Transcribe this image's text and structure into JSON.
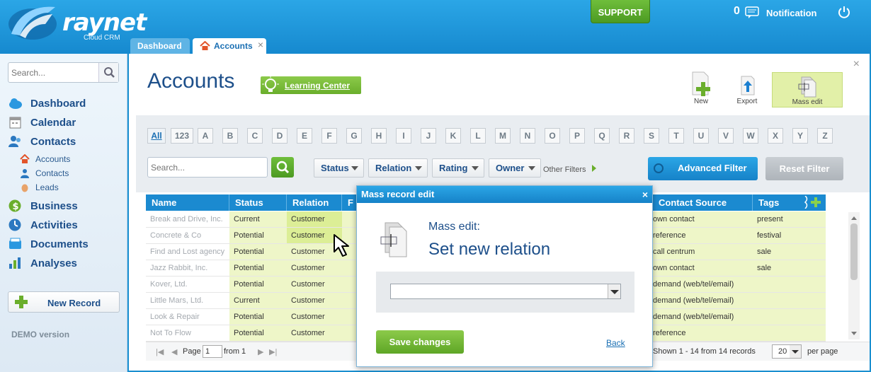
{
  "brand": {
    "name": "raynet",
    "subtitle": "Cloud CRM"
  },
  "header": {
    "support_label": "SUPPORT",
    "notification_count": "0",
    "notification_label": "Notification"
  },
  "tabs": [
    {
      "label": "Dashboard"
    },
    {
      "label": "Accounts",
      "close": "×"
    }
  ],
  "sidebar": {
    "search_placeholder": "Search...",
    "nav": [
      {
        "label": "Dashboard",
        "icon": "cloud-icon"
      },
      {
        "label": "Calendar",
        "icon": "calendar-icon"
      },
      {
        "label": "Contacts",
        "icon": "contacts-icon"
      }
    ],
    "subnav": [
      {
        "label": "Accounts",
        "icon": "home-icon"
      },
      {
        "label": "Contacts",
        "icon": "person-icon"
      },
      {
        "label": "Leads",
        "icon": "egg-icon"
      }
    ],
    "nav2": [
      {
        "label": "Business",
        "icon": "dollar-icon"
      },
      {
        "label": "Activities",
        "icon": "clock-icon"
      },
      {
        "label": "Documents",
        "icon": "documents-icon"
      },
      {
        "label": "Analyses",
        "icon": "bar-chart-icon"
      }
    ],
    "new_record_label": "New Record",
    "demo_label": "DEMO version"
  },
  "main": {
    "title": "Accounts",
    "learning_center": "Learning Center",
    "close": "×",
    "toolbar": {
      "new_label": "New",
      "export_label": "Export",
      "mass_edit_label": "Mass edit"
    },
    "alphabet": [
      "All",
      "123",
      "A",
      "B",
      "C",
      "D",
      "E",
      "F",
      "G",
      "H",
      "I",
      "J",
      "K",
      "L",
      "M",
      "N",
      "O",
      "P",
      "Q",
      "R",
      "S",
      "T",
      "U",
      "V",
      "W",
      "X",
      "Y",
      "Z"
    ],
    "search_placeholder": "Search...",
    "filters": [
      "Status",
      "Relation",
      "Rating",
      "Owner"
    ],
    "other_filters": "Other Filters",
    "advanced_filter": "Advanced Filter",
    "reset_filter": "Reset Filter"
  },
  "table": {
    "columns": [
      "Name",
      "Status",
      "Relation",
      "F",
      "Contact Source",
      "Tags"
    ],
    "rows": [
      {
        "name": "Break and Drive, Inc.",
        "status": "Current",
        "relation": "Customer",
        "source": "own contact",
        "tags": "present"
      },
      {
        "name": "Concrete & Co",
        "status": "Potential",
        "relation": "Customer",
        "source": "reference",
        "tags": "festival"
      },
      {
        "name": "Find and Lost agency",
        "status": "Potential",
        "relation": "Customer",
        "source": "call centrum",
        "tags": "sale"
      },
      {
        "name": "Jazz Rabbit, Inc.",
        "status": "Potential",
        "relation": "Customer",
        "source": "own contact",
        "tags": "sale"
      },
      {
        "name": "Kover, Ltd.",
        "status": "Potential",
        "relation": "Customer",
        "source": "demand (web/tel/email)",
        "tags": ""
      },
      {
        "name": "Little Mars, Ltd.",
        "status": "Current",
        "relation": "Customer",
        "source": "demand (web/tel/email)",
        "tags": ""
      },
      {
        "name": "Look & Repair",
        "status": "Potential",
        "relation": "Customer",
        "source": "demand (web/tel/email)",
        "tags": ""
      },
      {
        "name": "Not To Flow",
        "status": "Potential",
        "relation": "Customer",
        "source": "reference",
        "tags": ""
      }
    ],
    "pager": {
      "page_label": "Page",
      "page_value": "1",
      "from_label": "from 1",
      "shown": "Shown 1 - 14 from 14 records",
      "per_page_value": "20",
      "per_page_label": "per page"
    }
  },
  "modal": {
    "title": "Mass record edit",
    "close": "×",
    "subtitle": "Mass edit:",
    "heading": "Set new relation",
    "select_value": "",
    "save_label": "Save changes",
    "back_label": "Back"
  },
  "colors": {
    "accent_blue": "#1b8ad0",
    "green": "#6aae2c",
    "highlight": "#eef6c8"
  }
}
